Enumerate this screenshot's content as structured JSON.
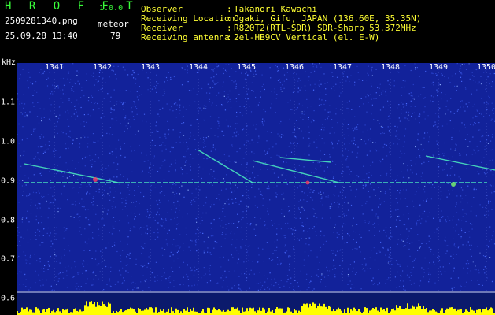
{
  "header": {
    "app_title": "H R O F F T",
    "app_version": "1.0.0",
    "filename": "2509281340.png",
    "datetime": "25.09.28 13:40",
    "mode_label": "meteor",
    "count": "79"
  },
  "info": [
    {
      "label": "Observer",
      "sep": ":",
      "value": "Takanori Kawachi"
    },
    {
      "label": "Receiving Location",
      "sep": ":",
      "value": "Ogaki, Gifu, JAPAN (136.60E, 35.35N)"
    },
    {
      "label": "Receiver",
      "sep": ":",
      "value": "R820T2(RTL-SDR) SDR-Sharp 53.372MHz"
    },
    {
      "label": "Receiving antenna",
      "sep": ":",
      "value": "2el-HB9CV Vertical (el. E-W)"
    }
  ],
  "spectrogram": {
    "y_unit": "kHz",
    "x_ticks": [
      "1341",
      "1342",
      "1343",
      "1344",
      "1345",
      "1346",
      "1347",
      "1348",
      "1349",
      "1350"
    ],
    "y_ticks": [
      "1.1",
      "1.0",
      "0.9",
      "0.8",
      "0.7",
      "0.6"
    ],
    "colors": {
      "background": "#12229a",
      "noise": "#4a6cff",
      "signal": "#4df0c0",
      "hot": "#ff4060",
      "meter": "#ffff00",
      "grid": "#d0d8ff"
    }
  }
}
